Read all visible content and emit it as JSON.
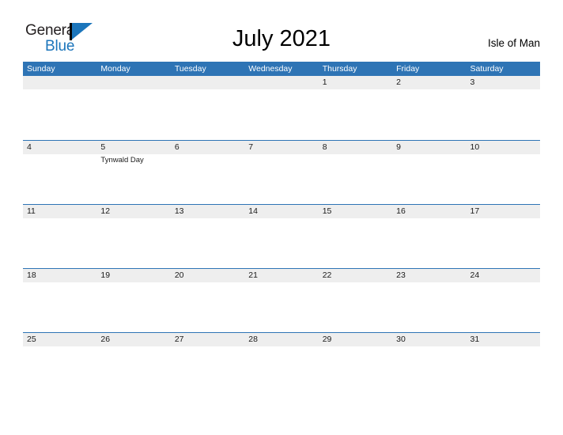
{
  "brand": {
    "name_part1": "General",
    "name_part2": "Blue",
    "flag_icon": "triangle-flag-icon",
    "color_dark": "#231f20",
    "color_blue": "#1b75bb"
  },
  "header": {
    "title": "July 2021",
    "region": "Isle of Man"
  },
  "calendar": {
    "accent_color": "#2e74b5",
    "band_color": "#eeeeee",
    "weekdays": [
      "Sunday",
      "Monday",
      "Tuesday",
      "Wednesday",
      "Thursday",
      "Friday",
      "Saturday"
    ],
    "weeks": [
      [
        {
          "day": "",
          "events": []
        },
        {
          "day": "",
          "events": []
        },
        {
          "day": "",
          "events": []
        },
        {
          "day": "",
          "events": []
        },
        {
          "day": "1",
          "events": []
        },
        {
          "day": "2",
          "events": []
        },
        {
          "day": "3",
          "events": []
        }
      ],
      [
        {
          "day": "4",
          "events": []
        },
        {
          "day": "5",
          "events": [
            "Tynwald Day"
          ]
        },
        {
          "day": "6",
          "events": []
        },
        {
          "day": "7",
          "events": []
        },
        {
          "day": "8",
          "events": []
        },
        {
          "day": "9",
          "events": []
        },
        {
          "day": "10",
          "events": []
        }
      ],
      [
        {
          "day": "11",
          "events": []
        },
        {
          "day": "12",
          "events": []
        },
        {
          "day": "13",
          "events": []
        },
        {
          "day": "14",
          "events": []
        },
        {
          "day": "15",
          "events": []
        },
        {
          "day": "16",
          "events": []
        },
        {
          "day": "17",
          "events": []
        }
      ],
      [
        {
          "day": "18",
          "events": []
        },
        {
          "day": "19",
          "events": []
        },
        {
          "day": "20",
          "events": []
        },
        {
          "day": "21",
          "events": []
        },
        {
          "day": "22",
          "events": []
        },
        {
          "day": "23",
          "events": []
        },
        {
          "day": "24",
          "events": []
        }
      ],
      [
        {
          "day": "25",
          "events": []
        },
        {
          "day": "26",
          "events": []
        },
        {
          "day": "27",
          "events": []
        },
        {
          "day": "28",
          "events": []
        },
        {
          "day": "29",
          "events": []
        },
        {
          "day": "30",
          "events": []
        },
        {
          "day": "31",
          "events": []
        }
      ]
    ]
  }
}
